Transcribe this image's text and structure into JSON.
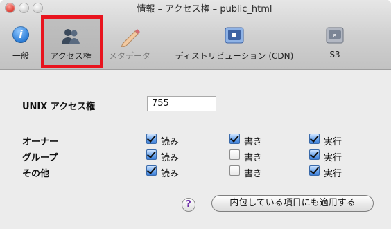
{
  "window": {
    "title": "情報 – アクセス権 – public_html",
    "controls": [
      "close-button",
      "minimize-button",
      "zoom-button"
    ]
  },
  "toolbar": {
    "items": [
      {
        "label": "一般",
        "icon": "info-icon",
        "selected": false
      },
      {
        "label": "アクセス権",
        "icon": "users-icon",
        "selected": true
      },
      {
        "label": "メタデータ",
        "icon": "pencil-icon",
        "selected": false
      },
      {
        "label": "ディストリビューション (CDN)",
        "icon": "book-icon",
        "selected": false
      },
      {
        "label": "S3",
        "icon": "bucket-icon",
        "selected": false
      }
    ],
    "highlight_color": "#e8141e"
  },
  "permissions": {
    "unix_label": "UNIX アクセス権",
    "unix_value": "755",
    "rows": [
      {
        "label": "オーナー",
        "read": true,
        "write": true,
        "execute": true
      },
      {
        "label": "グループ",
        "read": true,
        "write": false,
        "execute": true
      },
      {
        "label": "その他",
        "read": true,
        "write": false,
        "execute": true
      }
    ],
    "column_labels": {
      "read": "読み",
      "write": "書き",
      "execute": "実行"
    }
  },
  "footer": {
    "help_label": "?",
    "apply_button_label": "内包している項目にも適用する"
  }
}
